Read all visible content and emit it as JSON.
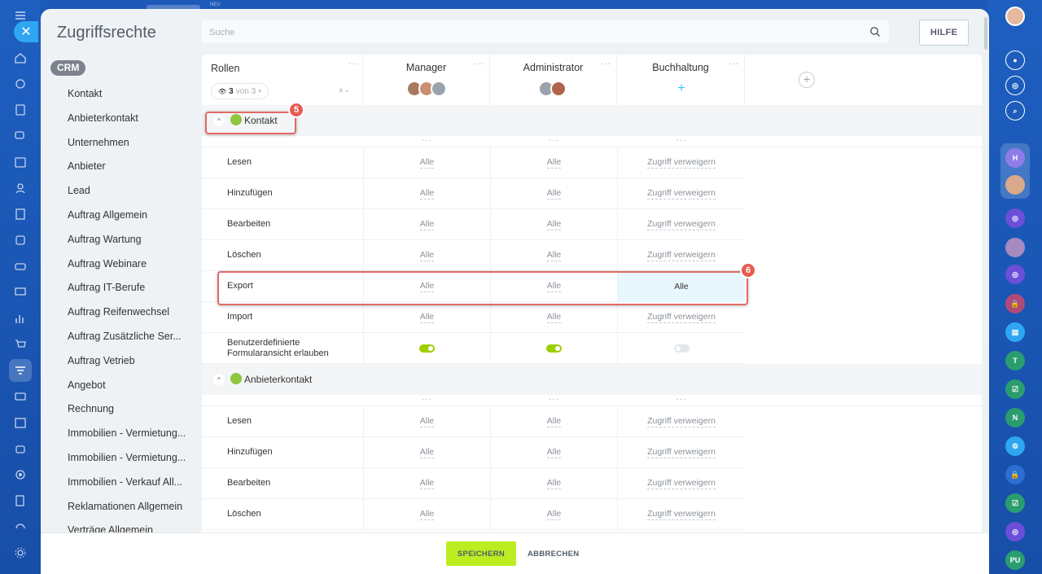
{
  "header": {
    "title": "Zugriffsrechte",
    "search_placeholder": "Suche",
    "help_label": "HILFE",
    "top_badge": "NEU"
  },
  "sidebar": {
    "badge": "CRM",
    "items": [
      "Kontakt",
      "Anbieterkontakt",
      "Unternehmen",
      "Anbieter",
      "Lead",
      "Auftrag Allgemein",
      "Auftrag Wartung",
      "Auftrag Webinare",
      "Auftrag IT-Berufe",
      "Auftrag Reifenwechsel",
      "Auftrag Zusätzliche Ser...",
      "Auftrag Vetrieb",
      "Angebot",
      "Rechnung",
      "Immobilien - Vermietung...",
      "Immobilien - Vermietung...",
      "Immobilien - Verkauf All...",
      "Reklamationen Allgemein",
      "Verträge Allgemein"
    ]
  },
  "table": {
    "roles_label": "Rollen",
    "filter": {
      "count": "3",
      "suffix": "von 3"
    },
    "columns": [
      "Manager",
      "Administrator",
      "Buchhaltung"
    ],
    "add_col_icon": "plus-circle-icon",
    "sections": [
      {
        "name": "Kontakt",
        "rows": [
          {
            "label": "Lesen",
            "values": [
              "Alle",
              "Alle",
              "Zugriff verweigern"
            ]
          },
          {
            "label": "Hinzufügen",
            "values": [
              "Alle",
              "Alle",
              "Zugriff verweigern"
            ]
          },
          {
            "label": "Bearbeiten",
            "values": [
              "Alle",
              "Alle",
              "Zugriff verweigern"
            ]
          },
          {
            "label": "Löschen",
            "values": [
              "Alle",
              "Alle",
              "Zugriff verweigern"
            ]
          },
          {
            "label": "Export",
            "values": [
              "Alle",
              "Alle",
              "Alle"
            ]
          },
          {
            "label": "Import",
            "values": [
              "Alle",
              "Alle",
              "Zugriff verweigern"
            ]
          },
          {
            "label": "Benutzerdefinierte Formularansicht erlauben",
            "toggles": [
              true,
              true,
              false
            ]
          }
        ]
      },
      {
        "name": "Anbieterkontakt",
        "rows": [
          {
            "label": "Lesen",
            "values": [
              "Alle",
              "Alle",
              "Zugriff verweigern"
            ]
          },
          {
            "label": "Hinzufügen",
            "values": [
              "Alle",
              "Alle",
              "Zugriff verweigern"
            ]
          },
          {
            "label": "Bearbeiten",
            "values": [
              "Alle",
              "Alle",
              "Zugriff verweigern"
            ]
          },
          {
            "label": "Löschen",
            "values": [
              "Alle",
              "Alle",
              "Zugriff verweigern"
            ]
          }
        ]
      }
    ]
  },
  "annotations": {
    "marker_section": "5",
    "marker_row": "6"
  },
  "footer": {
    "save_label": "SPEICHERN",
    "cancel_label": "ABBRECHEN"
  },
  "right_rail": {
    "avatar_letters": [
      "H",
      "T",
      "N",
      "PU"
    ]
  },
  "colors": {
    "accent_green": "#bbed21",
    "highlight": "#e06a67",
    "rail_blue": "#1d59b8"
  }
}
